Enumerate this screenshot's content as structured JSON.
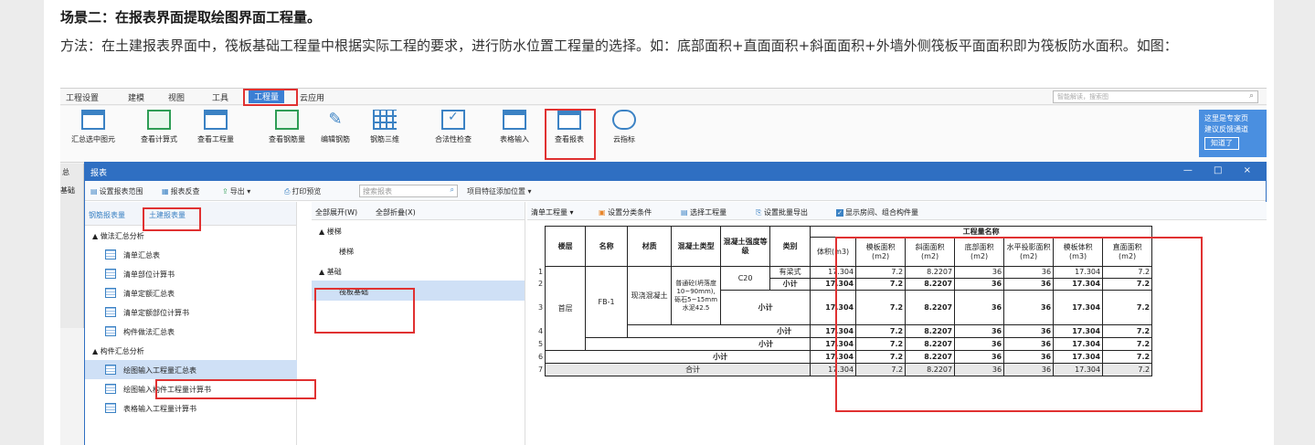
{
  "article": {
    "heading": "场景二：在报表界面提取绘图界面工程量。",
    "paragraph": "方法：在土建报表界面中，筏板基础工程量中根据实际工程的要求，进行防水位置工程量的选择。如：底部面积+直面面积+斜面面积+外墙外侧筏板平面面积即为筏板防水面积。如图："
  },
  "menubar": {
    "items": [
      "工程设置",
      "建模",
      "视图",
      "工具",
      "工程量",
      "云应用"
    ],
    "search_placeholder": "智能解读，搜索图"
  },
  "ribbon": {
    "buttons": [
      "汇总选中图元",
      "查看计算式",
      "查看工程量",
      "查看钢筋量",
      "编辑钢筋",
      "钢筋三维",
      "合法性检查",
      "表格输入",
      "查看报表",
      "云指标"
    ],
    "tip_lines": [
      "这里是专家页",
      "建议反馈通道"
    ],
    "tip_button": "知道了"
  },
  "left_stub": {
    "labels": [
      "总",
      "基础"
    ]
  },
  "report_window": {
    "title": "报表",
    "controls": "— □ ×",
    "toolbar": {
      "set_range": "设置报表范围",
      "review": "报表反查",
      "export": "导出 ▾",
      "print_preview": "打印预览",
      "search_placeholder": "搜索报表",
      "add_position": "项目特征添加位置 ▾"
    }
  },
  "left_pane": {
    "tab_rebar": "钢筋报表量",
    "tab_civil": "土建报表量",
    "groups": [
      {
        "label": "▲ 做法汇总分析",
        "items": [
          "清单汇总表",
          "清单部位计算书",
          "清单定额汇总表",
          "清单定额部位计算书",
          "构件做法汇总表"
        ]
      },
      {
        "label": "▲ 构件汇总分析",
        "items": [
          "绘图输入工程量汇总表",
          "绘图输入构件工程量计算书",
          "表格输入工程量计算书"
        ]
      }
    ]
  },
  "mid_pane": {
    "expand_all": "全部展开(W)",
    "collapse_all": "全部折叠(X)",
    "groups": [
      {
        "label": "▲ 楼梯",
        "child": "楼梯"
      },
      {
        "label": "▲ 基础",
        "child": "筏板基础"
      }
    ]
  },
  "right_pane": {
    "toolbar": {
      "dropdown": "清单工程量 ▾",
      "set_category": "设置分类条件",
      "select_qty": "选择工程量",
      "batch_export": "设置批量导出",
      "show_rooms": "显示房间、组合构件量"
    },
    "table": {
      "group_header": "工程量名称",
      "headers": [
        "楼层",
        "名称",
        "材质",
        "混凝土类型",
        "混凝土强度等级",
        "类别"
      ],
      "qty_headers": [
        "体积(m3)",
        "模板面积(m2)",
        "斜面面积(m2)",
        "底部面积(m2)",
        "水平投影面积(m2)",
        "模板体积(m3)",
        "直面面积(m2)"
      ],
      "row_numbers": [
        "1",
        "2",
        "3",
        "4",
        "5",
        "6",
        "7"
      ],
      "floor": "首层",
      "name": "FB-1",
      "material": "现浇混凝土",
      "concrete_type": "普通砼(坍落度10~90mm),砾石5~15mm水泥42.5",
      "grade": "C20",
      "category_beam": "有梁式",
      "subtotal": "小计",
      "total": "合计",
      "values": [
        "17.304",
        "7.2",
        "8.2207",
        "36",
        "36",
        "17.304",
        "7.2"
      ]
    }
  }
}
